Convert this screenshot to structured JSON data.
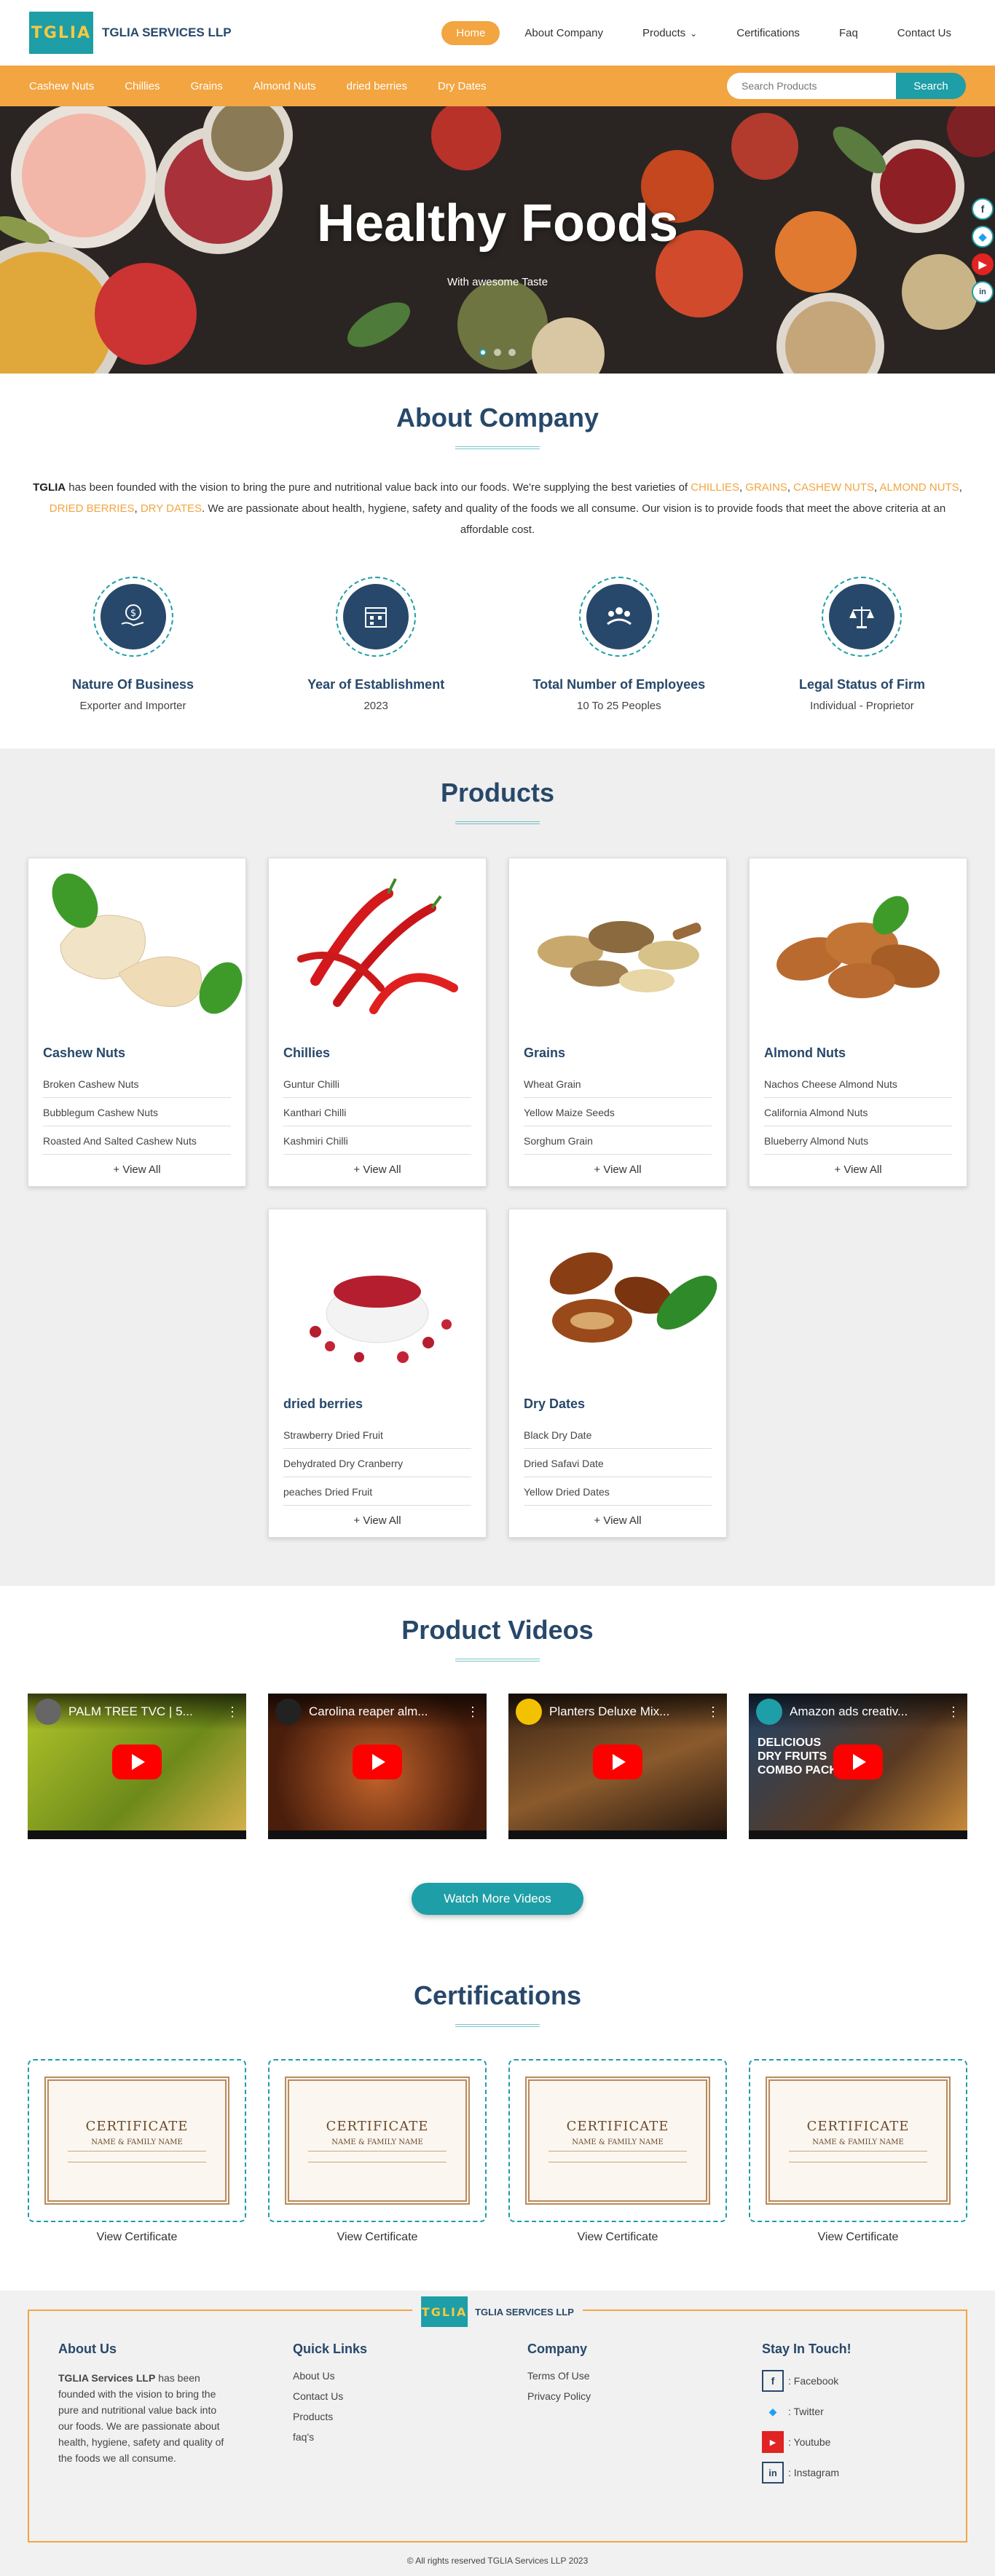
{
  "brand": {
    "logo_text": "TGLIA",
    "name": "TGLIA SERVICES LLP"
  },
  "nav": {
    "items": [
      {
        "label": "Home",
        "active": true
      },
      {
        "label": "About Company"
      },
      {
        "label": "Products",
        "has_dropdown": true
      },
      {
        "label": "Certifications"
      },
      {
        "label": "Faq"
      },
      {
        "label": "Contact Us"
      }
    ]
  },
  "categories": [
    "Cashew Nuts",
    "Chillies",
    "Grains",
    "Almond Nuts",
    "dried berries",
    "Dry Dates"
  ],
  "search": {
    "placeholder": "Search Products",
    "button": "Search"
  },
  "hero": {
    "title": "Healthy Foods",
    "subtitle": "With awesome Taste",
    "slides": 3,
    "active_slide": 1
  },
  "about": {
    "title": "About Company",
    "company": "TGLIA",
    "text1": " has been founded with the vision to bring the pure and nutritional value back into our foods. We're supplying the best varieties of ",
    "highlights": [
      "CHILLIES",
      "GRAINS",
      "CASHEW NUTS",
      "ALMOND NUTS",
      "DRIED BERRIES",
      "DRY DATES"
    ],
    "text2": ". We are passionate about health, hygiene, safety and quality of the foods we all consume. Our vision is to provide foods that meet the above criteria at an affordable cost.",
    "stats": [
      {
        "icon": "hand-coin-icon",
        "title": "Nature Of Business",
        "value": "Exporter and Importer"
      },
      {
        "icon": "calendar-icon",
        "title": "Year of Establishment",
        "value": "2023"
      },
      {
        "icon": "people-icon",
        "title": "Total Number of Employees",
        "value": "10 To 25 Peoples"
      },
      {
        "icon": "scales-icon",
        "title": "Legal Status of Firm",
        "value": "Individual - Proprietor"
      }
    ]
  },
  "products": {
    "title": "Products",
    "view_all": "+ View All",
    "items": [
      {
        "name": "Cashew Nuts",
        "image": "cashew-image",
        "list": [
          "Broken Cashew Nuts",
          "Bubblegum Cashew Nuts",
          "Roasted And Salted Cashew Nuts"
        ]
      },
      {
        "name": "Chillies",
        "image": "chilli-image",
        "list": [
          "Guntur Chilli",
          "Kanthari Chilli",
          "Kashmiri Chilli"
        ]
      },
      {
        "name": "Grains",
        "image": "grains-image",
        "list": [
          "Wheat Grain",
          "Yellow Maize Seeds",
          "Sorghum Grain"
        ]
      },
      {
        "name": "Almond Nuts",
        "image": "almond-image",
        "list": [
          "Nachos Cheese Almond Nuts",
          "California Almond Nuts",
          "Blueberry Almond Nuts"
        ]
      },
      {
        "name": "dried berries",
        "image": "berries-image",
        "list": [
          "Strawberry Dried Fruit",
          "Dehydrated Dry Cranberry",
          "peaches Dried Fruit"
        ]
      },
      {
        "name": "Dry Dates",
        "image": "dates-image",
        "list": [
          "Black Dry Date",
          "Dried Safavi Date",
          "Yellow Dried Dates"
        ]
      }
    ]
  },
  "videos": {
    "title": "Product Videos",
    "items": [
      "PALM TREE TVC | 5...",
      "Carolina reaper alm...",
      "Planters Deluxe Mix...",
      "Amazon ads creativ..."
    ],
    "overlay_text": [
      "DELICIOUS",
      "DRY FRUITS",
      "COMBO PACK"
    ],
    "button": "Watch More Videos"
  },
  "certifications": {
    "title": "Certifications",
    "cert_heading": "CERTIFICATE",
    "cert_name": "NAME & FAMILY NAME",
    "items": [
      "View Certificate",
      "View Certificate",
      "View Certificate",
      "View Certificate"
    ]
  },
  "footer": {
    "brand": "TGLIA SERVICES LLP",
    "about_title": "About Us",
    "about_company": "TGLIA Services LLP",
    "about_text": " has been founded with the vision to bring the pure and nutritional value back into our foods. We are passionate about health, hygiene, safety and quality of the foods we all consume.",
    "quick_title": "Quick Links",
    "quick_links": [
      "About Us",
      "Contact Us",
      "Products",
      "faq's"
    ],
    "company_title": "Company",
    "company_links": [
      "Terms Of Use",
      "Privacy Policy"
    ],
    "social_title": "Stay In Touch!",
    "social": [
      {
        "icon": "facebook-icon",
        "label": ": Facebook"
      },
      {
        "icon": "twitter-icon",
        "label": ": Twitter"
      },
      {
        "icon": "youtube-icon",
        "label": ": Youtube"
      },
      {
        "icon": "linkedin-icon",
        "label": ": Instagram"
      }
    ],
    "copyright": "© All rights reserved TGLIA Services LLP 2023"
  },
  "colors": {
    "primary": "#27486a",
    "accent": "#f2a541",
    "teal": "#1e9ea6"
  }
}
